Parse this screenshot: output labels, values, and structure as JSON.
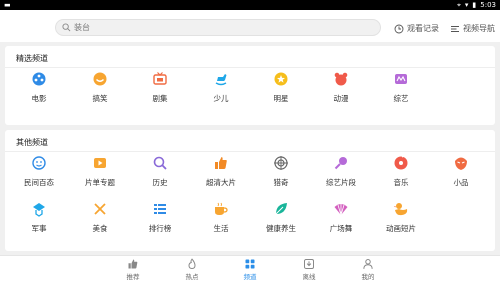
{
  "status": {
    "time": "5:03"
  },
  "search": {
    "placeholder": "装台"
  },
  "top": {
    "history": "观看记录",
    "nav": "视频导航"
  },
  "featured": {
    "title": "精选频道",
    "items": [
      {
        "label": "电影",
        "icon": "film-icon",
        "color": "#2f8be6"
      },
      {
        "label": "搞笑",
        "icon": "smile-icon",
        "color": "#f7a531"
      },
      {
        "label": "剧集",
        "icon": "tv-icon",
        "color": "#f06b42"
      },
      {
        "label": "少儿",
        "icon": "rocking-horse-icon",
        "color": "#1fa7e8"
      },
      {
        "label": "明星",
        "icon": "star-icon",
        "color": "#f6be1b"
      },
      {
        "label": "动漫",
        "icon": "anime-icon",
        "color": "#f05a4a"
      },
      {
        "label": "综艺",
        "icon": "variety-icon",
        "color": "#b56ad8"
      }
    ]
  },
  "other": {
    "title": "其他频道",
    "items": [
      {
        "label": "民间百态",
        "icon": "face-icon",
        "color": "#2f8be6"
      },
      {
        "label": "片单专题",
        "icon": "playlist-icon",
        "color": "#f7a531"
      },
      {
        "label": "历史",
        "icon": "magnifier-icon",
        "color": "#8a6ad8"
      },
      {
        "label": "超清大片",
        "icon": "thumbs-up-icon",
        "color": "#f28a25"
      },
      {
        "label": "猎奇",
        "icon": "target-icon",
        "color": "#666666"
      },
      {
        "label": "综艺片段",
        "icon": "microphone-icon",
        "color": "#b56ad8"
      },
      {
        "label": "音乐",
        "icon": "music-icon",
        "color": "#f05a4a"
      },
      {
        "label": "小品",
        "icon": "opera-mask-icon",
        "color": "#f06b42"
      },
      {
        "label": "军事",
        "icon": "military-icon",
        "color": "#1fa7e8"
      },
      {
        "label": "美食",
        "icon": "fork-knife-icon",
        "color": "#f7a531"
      },
      {
        "label": "排行榜",
        "icon": "ranking-icon",
        "color": "#2f8be6"
      },
      {
        "label": "生活",
        "icon": "coffee-icon",
        "color": "#f7a531"
      },
      {
        "label": "健康养生",
        "icon": "leaf-icon",
        "color": "#19b59a"
      },
      {
        "label": "广场舞",
        "icon": "fan-icon",
        "color": "#d35fbf"
      },
      {
        "label": "动画短片",
        "icon": "duck-icon",
        "color": "#f7a531"
      }
    ]
  },
  "tabs": [
    {
      "label": "推荐",
      "icon": "thumbs-up-icon",
      "active": false
    },
    {
      "label": "热点",
      "icon": "flame-icon",
      "active": false
    },
    {
      "label": "频道",
      "icon": "grid-icon",
      "active": true
    },
    {
      "label": "离线",
      "icon": "download-icon",
      "active": false
    },
    {
      "label": "我的",
      "icon": "person-icon",
      "active": false
    }
  ]
}
